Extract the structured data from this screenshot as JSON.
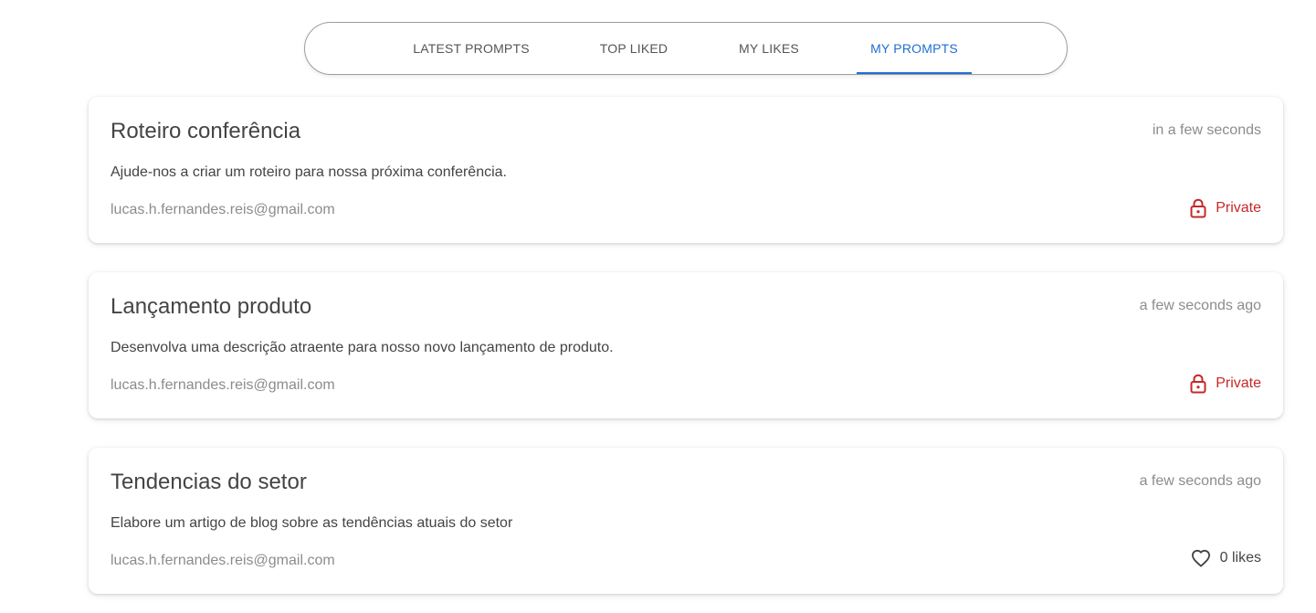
{
  "tabs": [
    {
      "label": "LATEST PROMPTS",
      "active": false
    },
    {
      "label": "TOP LIKED",
      "active": false
    },
    {
      "label": "MY LIKES",
      "active": false
    },
    {
      "label": "MY PROMPTS",
      "active": true
    }
  ],
  "accent_color": "#1f6fd0",
  "private_color": "#c62828",
  "prompts": [
    {
      "title": "Roteiro conferência",
      "time": "in a few seconds",
      "description": "Ajude-nos a criar um roteiro para nossa próxima conferência.",
      "author": "lucas.h.fernandes.reis@gmail.com",
      "status_icon": "lock-icon",
      "status_label": "Private"
    },
    {
      "title": "Lançamento produto",
      "time": "a few seconds ago",
      "description": "Desenvolva uma descrição atraente para nosso novo lançamento de produto.",
      "author": "lucas.h.fernandes.reis@gmail.com",
      "status_icon": "lock-icon",
      "status_label": "Private"
    },
    {
      "title": "Tendencias do setor",
      "time": "a few seconds ago",
      "description": "Elabore um artigo de blog sobre as tendências atuais do setor",
      "author": "lucas.h.fernandes.reis@gmail.com",
      "status_icon": "heart-icon",
      "status_label": "0 likes"
    }
  ]
}
